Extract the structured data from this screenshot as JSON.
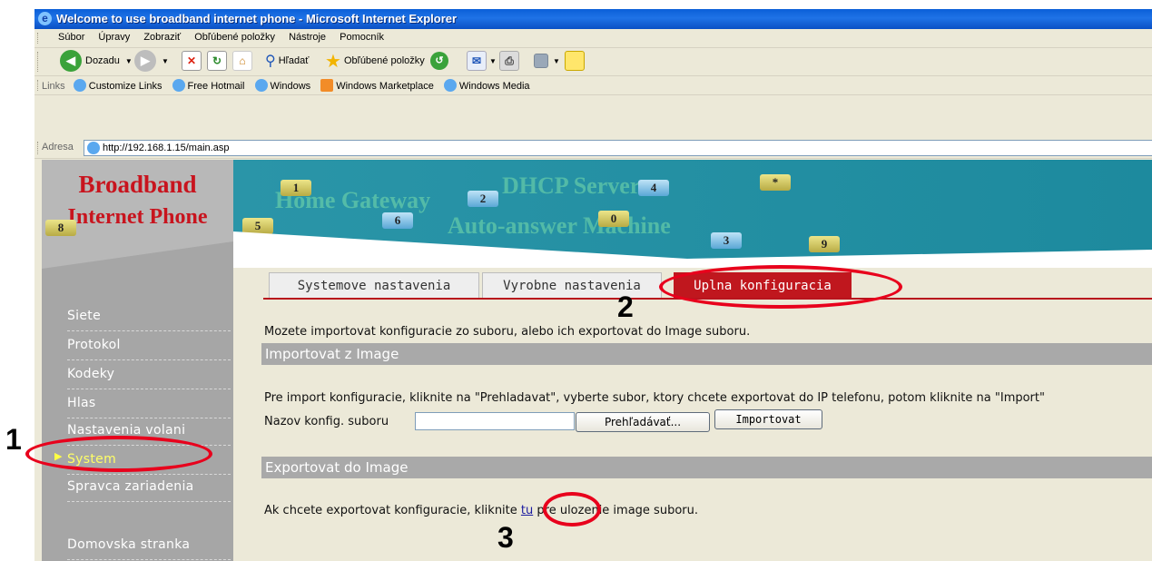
{
  "window": {
    "title": "Welcome to use broadband internet phone - Microsoft Internet Explorer"
  },
  "menu": [
    "Súbor",
    "Úpravy",
    "Zobraziť",
    "Obľúbené položky",
    "Nástroje",
    "Pomocník"
  ],
  "toolbar": {
    "back_label": "Dozadu",
    "search_label": "Hľadať",
    "favorites_label": "Obľúbené položky"
  },
  "links": {
    "label": "Links",
    "items": [
      "Customize Links",
      "Free Hotmail",
      "Windows",
      "Windows Marketplace",
      "Windows Media"
    ]
  },
  "address": {
    "label": "Adresa",
    "url": "http://192.168.1.15/main.asp"
  },
  "logo": {
    "line1": "Broadband",
    "line2": "Internet Phone"
  },
  "banner": {
    "text1": "Home Gateway",
    "text2": "DHCP Server",
    "text3": "Auto-answer Machine",
    "keys": [
      "1",
      "2",
      "4",
      "*",
      "5",
      "6",
      "0",
      "8",
      "3",
      "9"
    ]
  },
  "sidebar": {
    "items": [
      "Siete",
      "Protokol",
      "Kodeky",
      "Hlas",
      "Nastavenia volani",
      "System",
      "Spravca zariadenia",
      "Domovska stranka"
    ],
    "active_index": 5
  },
  "tabs": [
    "Systemove nastavenia",
    "Vyrobne nastavenia",
    "Uplna konfiguracia"
  ],
  "content": {
    "intro": "Mozete importovat konfiguracie zo suboru, alebo ich exportovat do Image suboru.",
    "import_header": "Importovat z Image",
    "import_desc": "Pre import konfiguracie, kliknite na \"Prehladavat\", vyberte subor, ktory chcete exportovat do IP telefonu, potom kliknite na \"Import\"",
    "file_label": "Nazov konfig. suboru",
    "file_value": "",
    "browse_label": "Prehľadávať...",
    "import_label": "Importovat",
    "export_header": "Exportovat do Image",
    "export_before": "Ak chcete exportovat konfiguracie, kliknite ",
    "export_link": "tu",
    "export_after": " pre ulozenie image suboru."
  },
  "annotations": [
    "1",
    "2",
    "3"
  ],
  "colors": {
    "annotation": "#e8001c",
    "tab_active": "#c0171e",
    "banner": "#2a95a8",
    "sidebar": "#a6a6a6"
  }
}
